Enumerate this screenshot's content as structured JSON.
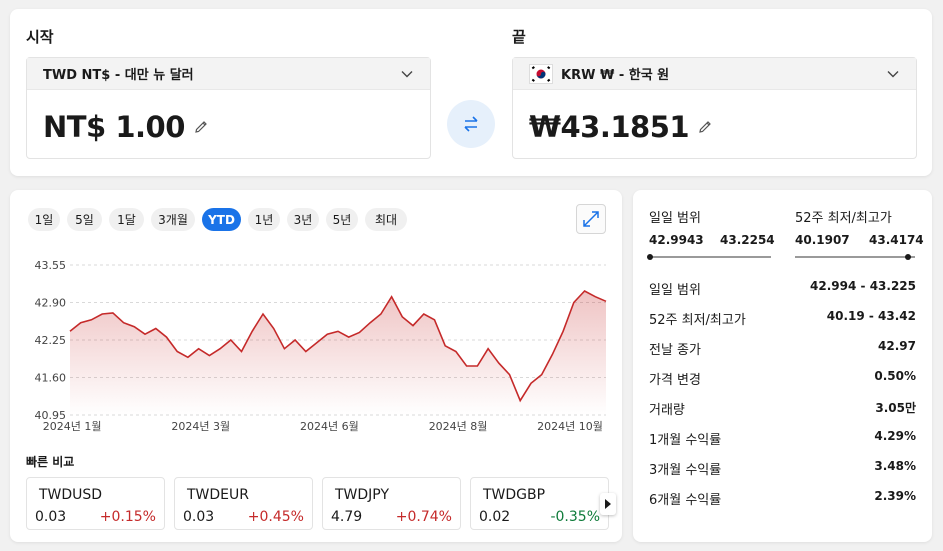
{
  "converter": {
    "from_label": "시작",
    "to_label": "끝",
    "from_currency": "TWD NT$ - 대만 뉴 달러",
    "to_currency": "KRW ₩ - 한국 원",
    "from_amount": "NT$ 1.00",
    "to_amount": "₩43.1851"
  },
  "periods": [
    "1일",
    "5일",
    "1달",
    "3개월",
    "YTD",
    "1년",
    "3년",
    "5년",
    "최대"
  ],
  "active_period": "YTD",
  "quick_compare": {
    "label": "빠른 비교",
    "items": [
      {
        "name": "TWDUSD",
        "price": "0.03",
        "change": "+0.15%",
        "dir": "up"
      },
      {
        "name": "TWDEUR",
        "price": "0.03",
        "change": "+0.45%",
        "dir": "up"
      },
      {
        "name": "TWDJPY",
        "price": "4.79",
        "change": "+0.74%",
        "dir": "up"
      },
      {
        "name": "TWDGBP",
        "price": "0.02",
        "change": "-0.35%",
        "dir": "down"
      }
    ]
  },
  "stats": {
    "day_range_title": "일일 범위",
    "day_low": "42.9943",
    "day_high": "43.2254",
    "week52_title": "52주 최저/최고가",
    "week52_low": "40.1907",
    "week52_high": "43.4174",
    "rows": [
      {
        "label": "일일 범위",
        "value": "42.994 - 43.225"
      },
      {
        "label": "52주 최저/최고가",
        "value": "40.19 - 43.42"
      },
      {
        "label": "전날 종가",
        "value": "42.97"
      },
      {
        "label": "가격 변경",
        "value": "0.50%"
      },
      {
        "label": "거래량",
        "value": "3.05만"
      },
      {
        "label": "1개월 수익률",
        "value": "4.29%"
      },
      {
        "label": "3개월 수익률",
        "value": "3.48%"
      },
      {
        "label": "6개월 수익률",
        "value": "2.39%"
      }
    ]
  },
  "colors": {
    "accent": "#1a73e8",
    "line": "#c52a2a",
    "positive": "#c52a2a",
    "negative": "#0f7b3a"
  },
  "chart_data": {
    "type": "area",
    "title": "",
    "xlabel": "",
    "ylabel": "",
    "ylim": [
      40.95,
      43.55
    ],
    "yticks": [
      "43.55",
      "42.90",
      "42.25",
      "41.60",
      "40.95"
    ],
    "xticks": [
      {
        "label": "2024년 1월",
        "x": 1
      },
      {
        "label": "2024년 3월",
        "x": 61
      },
      {
        "label": "2024년 6월",
        "x": 121
      },
      {
        "label": "2024년 8월",
        "x": 181
      },
      {
        "label": "2024년 10월",
        "x": 238
      }
    ],
    "grid": true,
    "x_range": [
      0,
      250
    ],
    "x": [
      0,
      5,
      10,
      15,
      20,
      25,
      30,
      35,
      40,
      45,
      50,
      55,
      60,
      65,
      70,
      75,
      80,
      85,
      90,
      95,
      100,
      105,
      110,
      115,
      120,
      125,
      130,
      135,
      140,
      145,
      150,
      155,
      160,
      165,
      170,
      175,
      180,
      185,
      190,
      195,
      200,
      205,
      210,
      215,
      220,
      225,
      230,
      235,
      240,
      245,
      250
    ],
    "values": [
      42.4,
      42.55,
      42.6,
      42.7,
      42.72,
      42.55,
      42.48,
      42.35,
      42.45,
      42.3,
      42.05,
      41.95,
      42.1,
      41.98,
      42.1,
      42.25,
      42.05,
      42.4,
      42.7,
      42.45,
      42.1,
      42.25,
      42.05,
      42.2,
      42.35,
      42.4,
      42.3,
      42.38,
      42.55,
      42.7,
      43.0,
      42.65,
      42.5,
      42.7,
      42.6,
      42.15,
      42.05,
      41.8,
      41.8,
      42.1,
      41.85,
      41.65,
      41.2,
      41.5,
      41.65,
      42.0,
      42.4,
      42.9,
      43.1,
      43.0,
      42.92
    ]
  }
}
